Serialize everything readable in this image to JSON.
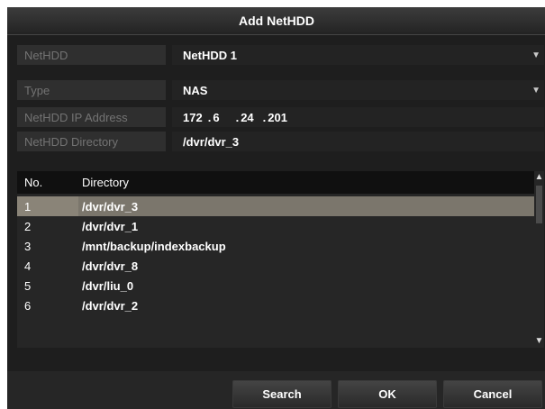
{
  "dialog": {
    "title": "Add NetHDD"
  },
  "form": {
    "nethdd": {
      "label": "NetHDD",
      "value": "NetHDD 1"
    },
    "type": {
      "label": "Type",
      "value": "NAS"
    },
    "ip": {
      "label": "NetHDD IP Address",
      "octets": [
        "172",
        "6",
        "24",
        "201"
      ]
    },
    "directory": {
      "label": "NetHDD Directory",
      "value": "/dvr/dvr_3"
    }
  },
  "table": {
    "headers": {
      "no": "No.",
      "directory": "Directory"
    },
    "rows": [
      {
        "no": "1",
        "directory": "/dvr/dvr_3",
        "selected": true
      },
      {
        "no": "2",
        "directory": "/dvr/dvr_1",
        "selected": false
      },
      {
        "no": "3",
        "directory": "/mnt/backup/indexbackup",
        "selected": false
      },
      {
        "no": "4",
        "directory": "/dvr/dvr_8",
        "selected": false
      },
      {
        "no": "5",
        "directory": "/dvr/liu_0",
        "selected": false
      },
      {
        "no": "6",
        "directory": "/dvr/dvr_2",
        "selected": false
      }
    ]
  },
  "buttons": {
    "search": "Search",
    "ok": "OK",
    "cancel": "Cancel"
  },
  "icons": {
    "dropdown": "chevron-down-icon",
    "scroll_up": "chevron-up-icon",
    "scroll_down": "chevron-down-icon"
  },
  "colors": {
    "dialog_bg": "#1e1e1e",
    "selected_row": "#7b766c",
    "header_bg": "#101010"
  }
}
